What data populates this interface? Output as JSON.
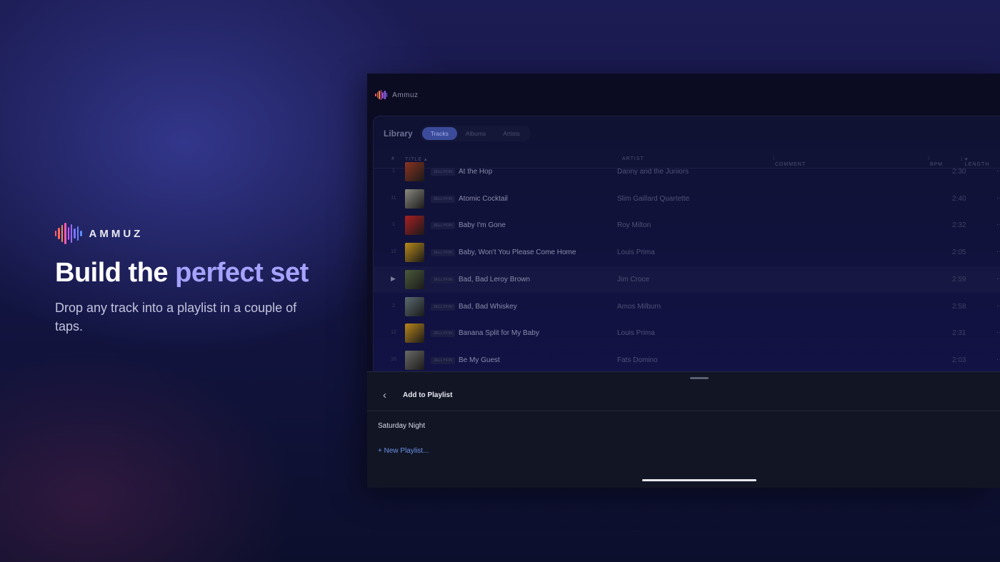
{
  "brand": {
    "name": "AMMUZ"
  },
  "hero": {
    "headline_plain": "Build the ",
    "headline_accent": "perfect set",
    "subline": "Drop any track into a playlist in a couple of taps."
  },
  "colors": {
    "accent": "#a6a2ff",
    "link": "#6d92e6",
    "active_tab": "#3b4b9a"
  },
  "app": {
    "window_title": "Ammuz",
    "library": {
      "title": "Library",
      "tabs": [
        {
          "label": "Tracks",
          "active": true
        },
        {
          "label": "Albums",
          "active": false
        },
        {
          "label": "Artists",
          "active": false
        }
      ],
      "columns": {
        "num": "#",
        "title": "TITLE ▴",
        "artist": "ARTIST",
        "comment": "COMMENT",
        "bpm": "BPM",
        "length": "LENGTH"
      },
      "rows": [
        {
          "num": "1",
          "source": "JELLYFIN",
          "title": "At the Hop",
          "artist": "Danny and the Juniors",
          "length": "2:30",
          "more": "···",
          "highlight": false,
          "playing": false,
          "thumb": "#8a3320"
        },
        {
          "num": "11",
          "source": "JELLYFIN",
          "title": "Atomic Cocktail",
          "artist": "Slim Gaillard Quartette",
          "length": "2:40",
          "more": "···",
          "highlight": false,
          "playing": false,
          "thumb": "#8a8a80"
        },
        {
          "num": "1",
          "source": "JELLYFIN",
          "title": "Baby I'm Gone",
          "artist": "Roy Milton",
          "length": "2:32",
          "more": "···",
          "highlight": false,
          "playing": false,
          "thumb": "#a81f22"
        },
        {
          "num": "12",
          "source": "JELLYFIN",
          "title": "Baby, Won't You Please Come Home",
          "artist": "Louis Prima",
          "length": "2:05",
          "more": "···",
          "highlight": false,
          "playing": false,
          "thumb": "#b88a1a"
        },
        {
          "num": "▶",
          "source": "JELLYFIN",
          "title": "Bad, Bad Leroy Brown",
          "artist": "Jim Croce",
          "length": "2:59",
          "more": "···",
          "highlight": true,
          "playing": true,
          "thumb": "#4a5a3a"
        },
        {
          "num": "2",
          "source": "JELLYFIN",
          "title": "Bad, Bad Whiskey",
          "artist": "Amos Milburn",
          "length": "2:58",
          "more": "···",
          "highlight": false,
          "playing": false,
          "thumb": "#5a6a70"
        },
        {
          "num": "12",
          "source": "JELLYFIN",
          "title": "Banana Split for My Baby",
          "artist": "Louis Prima",
          "length": "2:31",
          "more": "···",
          "highlight": false,
          "playing": false,
          "thumb": "#b8861a"
        },
        {
          "num": "16",
          "source": "JELLYFIN",
          "title": "Be My Guest",
          "artist": "Fats Domino",
          "length": "2:03",
          "more": "···",
          "highlight": false,
          "playing": false,
          "thumb": "#6a6a66"
        }
      ]
    },
    "sheet": {
      "back_icon": "‹",
      "title": "Add to Playlist",
      "playlists": [
        "Saturday Night"
      ],
      "new_playlist": "+ New Playlist..."
    }
  }
}
